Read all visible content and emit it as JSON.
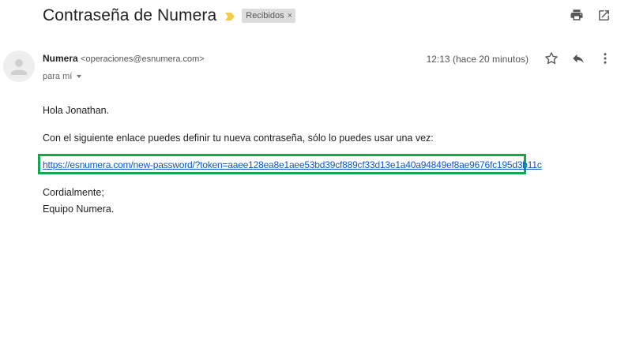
{
  "email": {
    "subject": "Contraseña de Numera",
    "label": "Recibidos",
    "label_close": "×",
    "sender": {
      "name": "Numera",
      "email": "<operaciones@esnumera.com>"
    },
    "recipient": "para mí",
    "timestamp": "12:13 (hace 20 minutos)",
    "body": {
      "greeting": "Hola Jonathan.",
      "intro": "Con el siguiente enlace puedes definir tu nueva contraseña, sólo lo puedes usar una vez:",
      "link": "https://esnumera.com/new-password/?token=aaee128ea8e1aee53bd39cf889cf33d13e1a40a94849ef8ae9676fc195d3b11c",
      "closing": "Cordialmente;",
      "signature": "Equipo Numera."
    }
  },
  "icons": {
    "importance": "importance-marker-icon",
    "print": "print-icon",
    "open_new_window": "open-in-new-window-icon",
    "avatar": "default-avatar-icon",
    "star": "star-icon",
    "reply": "reply-icon",
    "more": "more-vert-icon"
  },
  "colors": {
    "importance": "#f7c948",
    "label_bg": "#dddddd",
    "link": "#1155cc",
    "highlight_box": "#11a84e",
    "icon": "#555555"
  }
}
